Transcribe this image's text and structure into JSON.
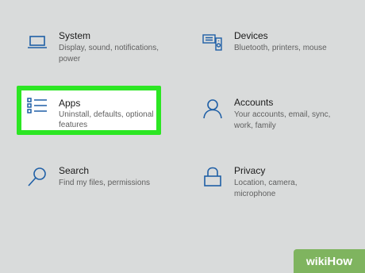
{
  "settings": {
    "icon_color": "#1f5fa6",
    "highlight_color": "#2ce623",
    "tiles": [
      {
        "title": "System",
        "description": "Display, sound, notifications, power",
        "icon": "laptop-icon"
      },
      {
        "title": "Devices",
        "description": "Bluetooth, printers, mouse",
        "icon": "devices-icon"
      },
      {
        "title": "Apps",
        "description": "Uninstall, defaults, optional features",
        "icon": "apps-list-icon"
      },
      {
        "title": "Accounts",
        "description": "Your accounts, email, sync, work, family",
        "icon": "person-icon"
      },
      {
        "title": "Search",
        "description": "Find my files, permissions",
        "icon": "search-icon"
      },
      {
        "title": "Privacy",
        "description": "Location, camera, microphone",
        "icon": "lock-icon"
      }
    ]
  },
  "watermark": {
    "prefix": "wiki",
    "suffix": "How",
    "color": "#7fb45f"
  }
}
